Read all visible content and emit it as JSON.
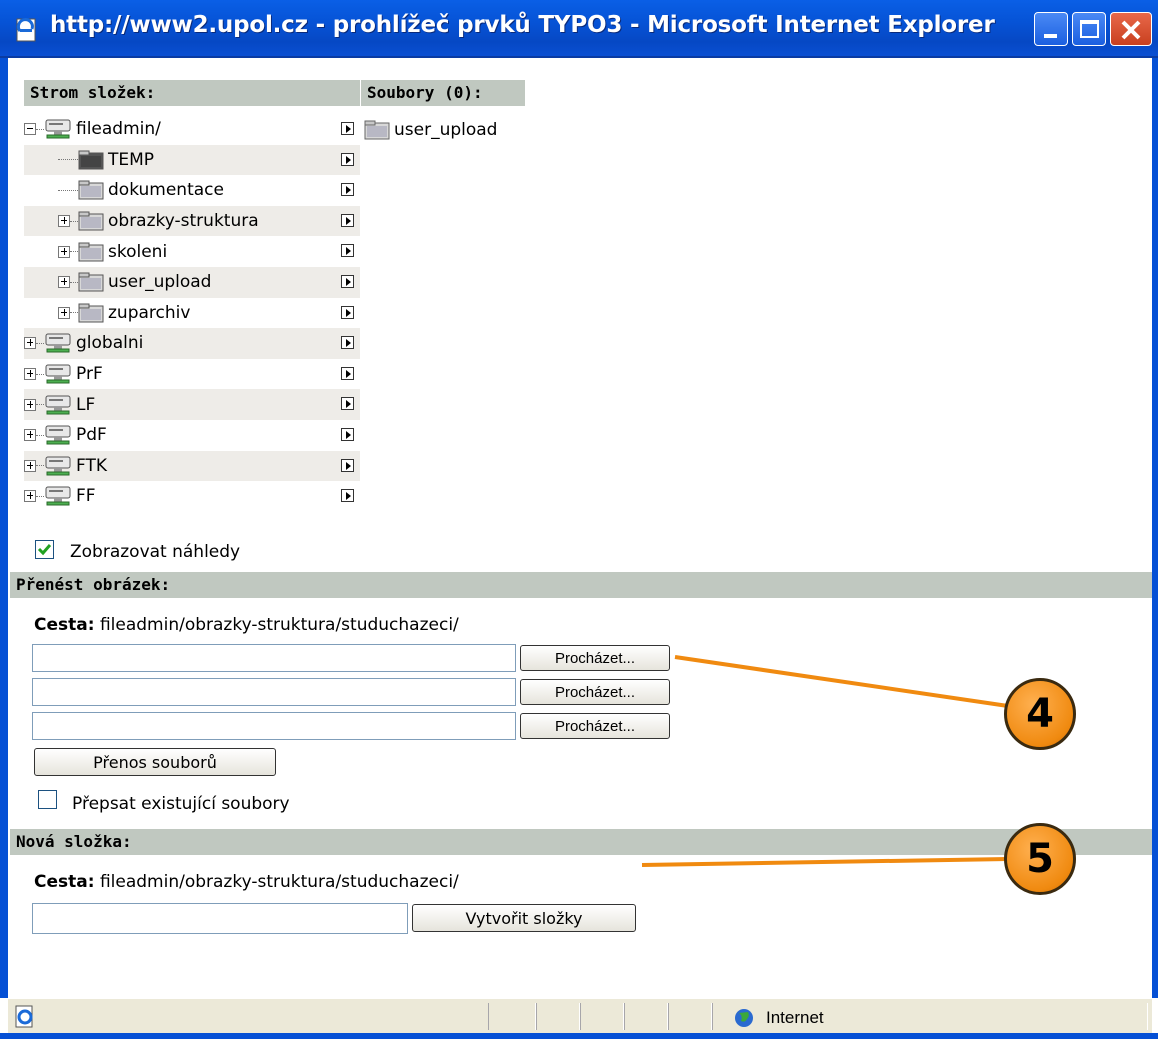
{
  "window": {
    "title": "http://www2.upol.cz - prohlížeč prvků TYPO3 - Microsoft Internet Explorer"
  },
  "tree": {
    "header": "Strom složek:",
    "items": [
      {
        "label": "fileadmin/",
        "level": 0,
        "icon": "server-icon",
        "toggle": "minus"
      },
      {
        "label": "TEMP",
        "level": 1,
        "icon": "temp-folder-icon",
        "toggle": "none"
      },
      {
        "label": "dokumentace",
        "level": 1,
        "icon": "folder-icon",
        "toggle": "none"
      },
      {
        "label": "obrazky-struktura",
        "level": 1,
        "icon": "folder-icon",
        "toggle": "plus"
      },
      {
        "label": "skoleni",
        "level": 1,
        "icon": "folder-icon",
        "toggle": "plus"
      },
      {
        "label": "user_upload",
        "level": 1,
        "icon": "folder-icon",
        "toggle": "plus"
      },
      {
        "label": "zuparchiv",
        "level": 1,
        "icon": "folder-icon",
        "toggle": "plus"
      },
      {
        "label": "globalni",
        "level": 0,
        "icon": "server-icon",
        "toggle": "plus"
      },
      {
        "label": "PrF",
        "level": 0,
        "icon": "server-icon",
        "toggle": "plus"
      },
      {
        "label": "LF",
        "level": 0,
        "icon": "server-icon",
        "toggle": "plus"
      },
      {
        "label": "PdF",
        "level": 0,
        "icon": "server-icon",
        "toggle": "plus"
      },
      {
        "label": "FTK",
        "level": 0,
        "icon": "server-icon",
        "toggle": "plus"
      },
      {
        "label": "FF",
        "level": 0,
        "icon": "server-icon",
        "toggle": "plus"
      }
    ]
  },
  "files": {
    "header": "Soubory (0):",
    "items": [
      "user_upload"
    ]
  },
  "preview": {
    "label": "Zobrazovat náhledy",
    "checked": true
  },
  "upload": {
    "header": "Přenést obrázek:",
    "path_label": "Cesta:",
    "path_value": "fileadmin/obrazky-struktura/studuchazeci/",
    "browse_label": "Procházet...",
    "submit_label": "Přenos souborů",
    "overwrite_label": "Přepsat existující soubory",
    "overwrite_checked": false
  },
  "new_folder": {
    "header": "Nová složka:",
    "path_label": "Cesta:",
    "path_value": "fileadmin/obrazky-struktura/studuchazeci/",
    "create_label": "Vytvořit složky"
  },
  "callouts": [
    "4",
    "5"
  ],
  "statusbar": {
    "zone": "Internet"
  },
  "colors": {
    "titlebar": "#0653d6",
    "section_header": "#c0c8c0",
    "callout": "#f08a10"
  }
}
